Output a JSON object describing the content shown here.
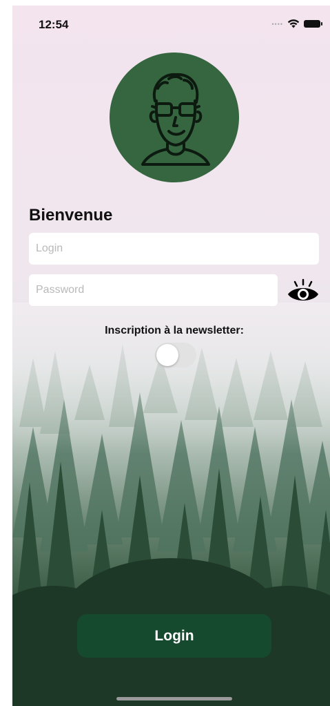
{
  "status_bar": {
    "time": "12:54",
    "signal_icon": "signal-dots-icon",
    "wifi_icon": "wifi-icon",
    "battery_icon": "battery-icon"
  },
  "avatar": {
    "icon": "person-with-glasses-icon",
    "background_color": "#356640"
  },
  "welcome_title": "Bienvenue",
  "login_input": {
    "value": "",
    "placeholder": "Login"
  },
  "password_input": {
    "value": "",
    "placeholder": "Password"
  },
  "show_password": {
    "icon": "eye-icon"
  },
  "newsletter": {
    "label": "Inscription à la newsletter:",
    "enabled": false
  },
  "login_button": {
    "label": "Login",
    "color": "#164a2f"
  }
}
